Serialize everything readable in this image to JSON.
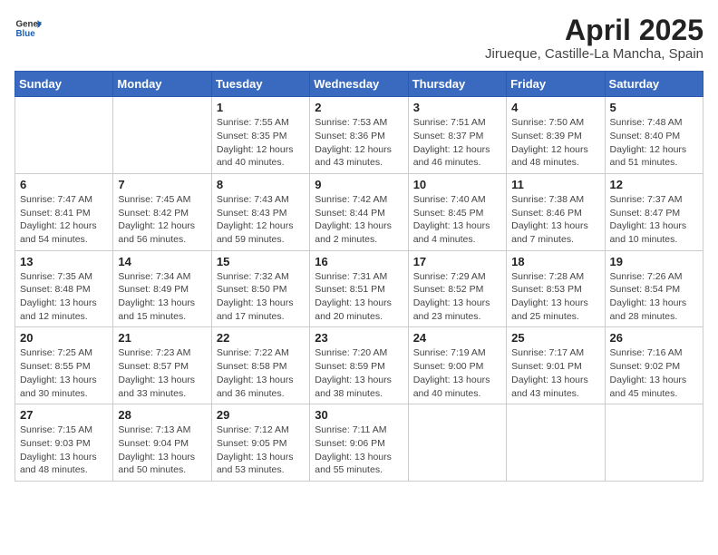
{
  "header": {
    "logo_general": "General",
    "logo_blue": "Blue",
    "month_title": "April 2025",
    "location": "Jirueque, Castille-La Mancha, Spain"
  },
  "weekdays": [
    "Sunday",
    "Monday",
    "Tuesday",
    "Wednesday",
    "Thursday",
    "Friday",
    "Saturday"
  ],
  "weeks": [
    [
      {
        "day": "",
        "info": ""
      },
      {
        "day": "",
        "info": ""
      },
      {
        "day": "1",
        "info": "Sunrise: 7:55 AM\nSunset: 8:35 PM\nDaylight: 12 hours and 40 minutes."
      },
      {
        "day": "2",
        "info": "Sunrise: 7:53 AM\nSunset: 8:36 PM\nDaylight: 12 hours and 43 minutes."
      },
      {
        "day": "3",
        "info": "Sunrise: 7:51 AM\nSunset: 8:37 PM\nDaylight: 12 hours and 46 minutes."
      },
      {
        "day": "4",
        "info": "Sunrise: 7:50 AM\nSunset: 8:39 PM\nDaylight: 12 hours and 48 minutes."
      },
      {
        "day": "5",
        "info": "Sunrise: 7:48 AM\nSunset: 8:40 PM\nDaylight: 12 hours and 51 minutes."
      }
    ],
    [
      {
        "day": "6",
        "info": "Sunrise: 7:47 AM\nSunset: 8:41 PM\nDaylight: 12 hours and 54 minutes."
      },
      {
        "day": "7",
        "info": "Sunrise: 7:45 AM\nSunset: 8:42 PM\nDaylight: 12 hours and 56 minutes."
      },
      {
        "day": "8",
        "info": "Sunrise: 7:43 AM\nSunset: 8:43 PM\nDaylight: 12 hours and 59 minutes."
      },
      {
        "day": "9",
        "info": "Sunrise: 7:42 AM\nSunset: 8:44 PM\nDaylight: 13 hours and 2 minutes."
      },
      {
        "day": "10",
        "info": "Sunrise: 7:40 AM\nSunset: 8:45 PM\nDaylight: 13 hours and 4 minutes."
      },
      {
        "day": "11",
        "info": "Sunrise: 7:38 AM\nSunset: 8:46 PM\nDaylight: 13 hours and 7 minutes."
      },
      {
        "day": "12",
        "info": "Sunrise: 7:37 AM\nSunset: 8:47 PM\nDaylight: 13 hours and 10 minutes."
      }
    ],
    [
      {
        "day": "13",
        "info": "Sunrise: 7:35 AM\nSunset: 8:48 PM\nDaylight: 13 hours and 12 minutes."
      },
      {
        "day": "14",
        "info": "Sunrise: 7:34 AM\nSunset: 8:49 PM\nDaylight: 13 hours and 15 minutes."
      },
      {
        "day": "15",
        "info": "Sunrise: 7:32 AM\nSunset: 8:50 PM\nDaylight: 13 hours and 17 minutes."
      },
      {
        "day": "16",
        "info": "Sunrise: 7:31 AM\nSunset: 8:51 PM\nDaylight: 13 hours and 20 minutes."
      },
      {
        "day": "17",
        "info": "Sunrise: 7:29 AM\nSunset: 8:52 PM\nDaylight: 13 hours and 23 minutes."
      },
      {
        "day": "18",
        "info": "Sunrise: 7:28 AM\nSunset: 8:53 PM\nDaylight: 13 hours and 25 minutes."
      },
      {
        "day": "19",
        "info": "Sunrise: 7:26 AM\nSunset: 8:54 PM\nDaylight: 13 hours and 28 minutes."
      }
    ],
    [
      {
        "day": "20",
        "info": "Sunrise: 7:25 AM\nSunset: 8:55 PM\nDaylight: 13 hours and 30 minutes."
      },
      {
        "day": "21",
        "info": "Sunrise: 7:23 AM\nSunset: 8:57 PM\nDaylight: 13 hours and 33 minutes."
      },
      {
        "day": "22",
        "info": "Sunrise: 7:22 AM\nSunset: 8:58 PM\nDaylight: 13 hours and 36 minutes."
      },
      {
        "day": "23",
        "info": "Sunrise: 7:20 AM\nSunset: 8:59 PM\nDaylight: 13 hours and 38 minutes."
      },
      {
        "day": "24",
        "info": "Sunrise: 7:19 AM\nSunset: 9:00 PM\nDaylight: 13 hours and 40 minutes."
      },
      {
        "day": "25",
        "info": "Sunrise: 7:17 AM\nSunset: 9:01 PM\nDaylight: 13 hours and 43 minutes."
      },
      {
        "day": "26",
        "info": "Sunrise: 7:16 AM\nSunset: 9:02 PM\nDaylight: 13 hours and 45 minutes."
      }
    ],
    [
      {
        "day": "27",
        "info": "Sunrise: 7:15 AM\nSunset: 9:03 PM\nDaylight: 13 hours and 48 minutes."
      },
      {
        "day": "28",
        "info": "Sunrise: 7:13 AM\nSunset: 9:04 PM\nDaylight: 13 hours and 50 minutes."
      },
      {
        "day": "29",
        "info": "Sunrise: 7:12 AM\nSunset: 9:05 PM\nDaylight: 13 hours and 53 minutes."
      },
      {
        "day": "30",
        "info": "Sunrise: 7:11 AM\nSunset: 9:06 PM\nDaylight: 13 hours and 55 minutes."
      },
      {
        "day": "",
        "info": ""
      },
      {
        "day": "",
        "info": ""
      },
      {
        "day": "",
        "info": ""
      }
    ]
  ]
}
